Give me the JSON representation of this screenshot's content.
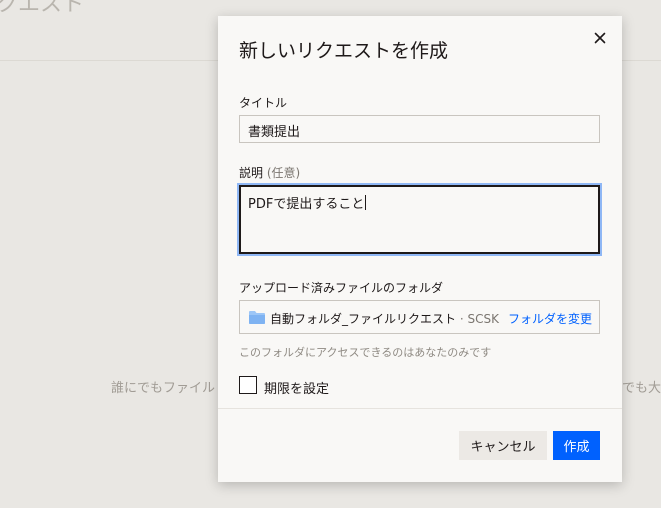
{
  "background": {
    "title_fragment": "クエスト",
    "text_left": "誰にでもファイル",
    "text_right": "でも大丈"
  },
  "dialog": {
    "title": "新しいリクエストを作成",
    "close_icon": "close-icon",
    "title_field": {
      "label": "タイトル",
      "value": "書類提出"
    },
    "description_field": {
      "label": "説明",
      "optional_label": "(任意)",
      "value": "PDFで提出すること"
    },
    "folder": {
      "label": "アップロード済みファイルのフォルダ",
      "icon": "folder-icon",
      "name": "自動フォルダ_ファイルリクエスト",
      "owner": " · SCSK",
      "change_label": "フォルダを変更",
      "helper": "このフォルダにアクセスできるのはあなたのみです"
    },
    "deadline": {
      "label": "期限を設定",
      "checked": false
    },
    "buttons": {
      "cancel": "キャンセル",
      "create": "作成"
    }
  },
  "colors": {
    "accent": "#0061fe",
    "focus_ring": "#8fb7f5",
    "folder": "#9cc6f7"
  }
}
